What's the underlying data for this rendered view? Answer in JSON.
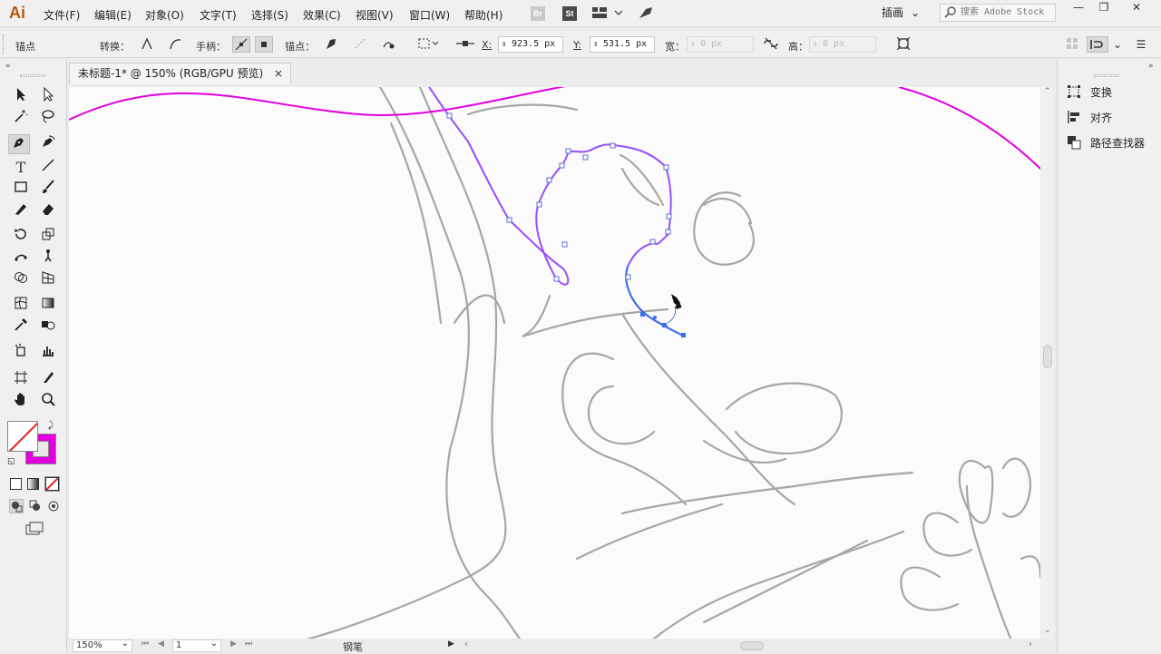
{
  "app": {
    "logo": "Ai"
  },
  "menu": [
    "文件(F)",
    "编辑(E)",
    "对象(O)",
    "文字(T)",
    "选择(S)",
    "效果(C)",
    "视图(V)",
    "窗口(W)",
    "帮助(H)"
  ],
  "bridge_buttons": {
    "br": "Br",
    "st": "St"
  },
  "workspace": {
    "label": "插画"
  },
  "search": {
    "placeholder": "搜索 Adobe Stock"
  },
  "window_controls": {
    "minimize": "—",
    "restore": "❐",
    "close": "✕"
  },
  "control_bar": {
    "context_label": "锚点",
    "convert_label": "转换：",
    "handles_label": "手柄：",
    "anchors_label": "锚点：",
    "x_label": "X:",
    "x_value": "923.5 px",
    "y_label": "Y:",
    "y_value": "531.5 px",
    "w_label": "宽：",
    "w_value": "0 px",
    "h_label": "高：",
    "h_value": "0 px"
  },
  "document_tab": {
    "title": "未标题-1* @ 150% (RGB/GPU 预览)",
    "close": "×"
  },
  "status_bar": {
    "zoom": "150%",
    "page": "1",
    "tool": "钢笔"
  },
  "right_panel": {
    "items": [
      "变换",
      "对齐",
      "路径查找器"
    ]
  },
  "colors": {
    "accent_magenta": "#e000e0",
    "path_purple": "#9b4dff",
    "anchor_blue": "#3a6ee8"
  },
  "icons": [
    "selection-icon",
    "direct-selection-icon",
    "magic-wand-icon",
    "lasso-icon",
    "pen-icon",
    "curvature-icon",
    "type-icon",
    "line-icon",
    "rectangle-icon",
    "paintbrush-icon",
    "shaper-icon",
    "eraser-icon",
    "rotate-icon",
    "scale-icon",
    "puppet-warp-icon",
    "free-transform-icon",
    "shape-builder-icon",
    "perspective-icon",
    "mesh-icon",
    "gradient-icon",
    "eyedropper-icon",
    "blend-icon",
    "symbol-sprayer-icon",
    "graph-icon",
    "artboard-icon",
    "slice-icon",
    "hand-icon",
    "zoom-icon"
  ]
}
